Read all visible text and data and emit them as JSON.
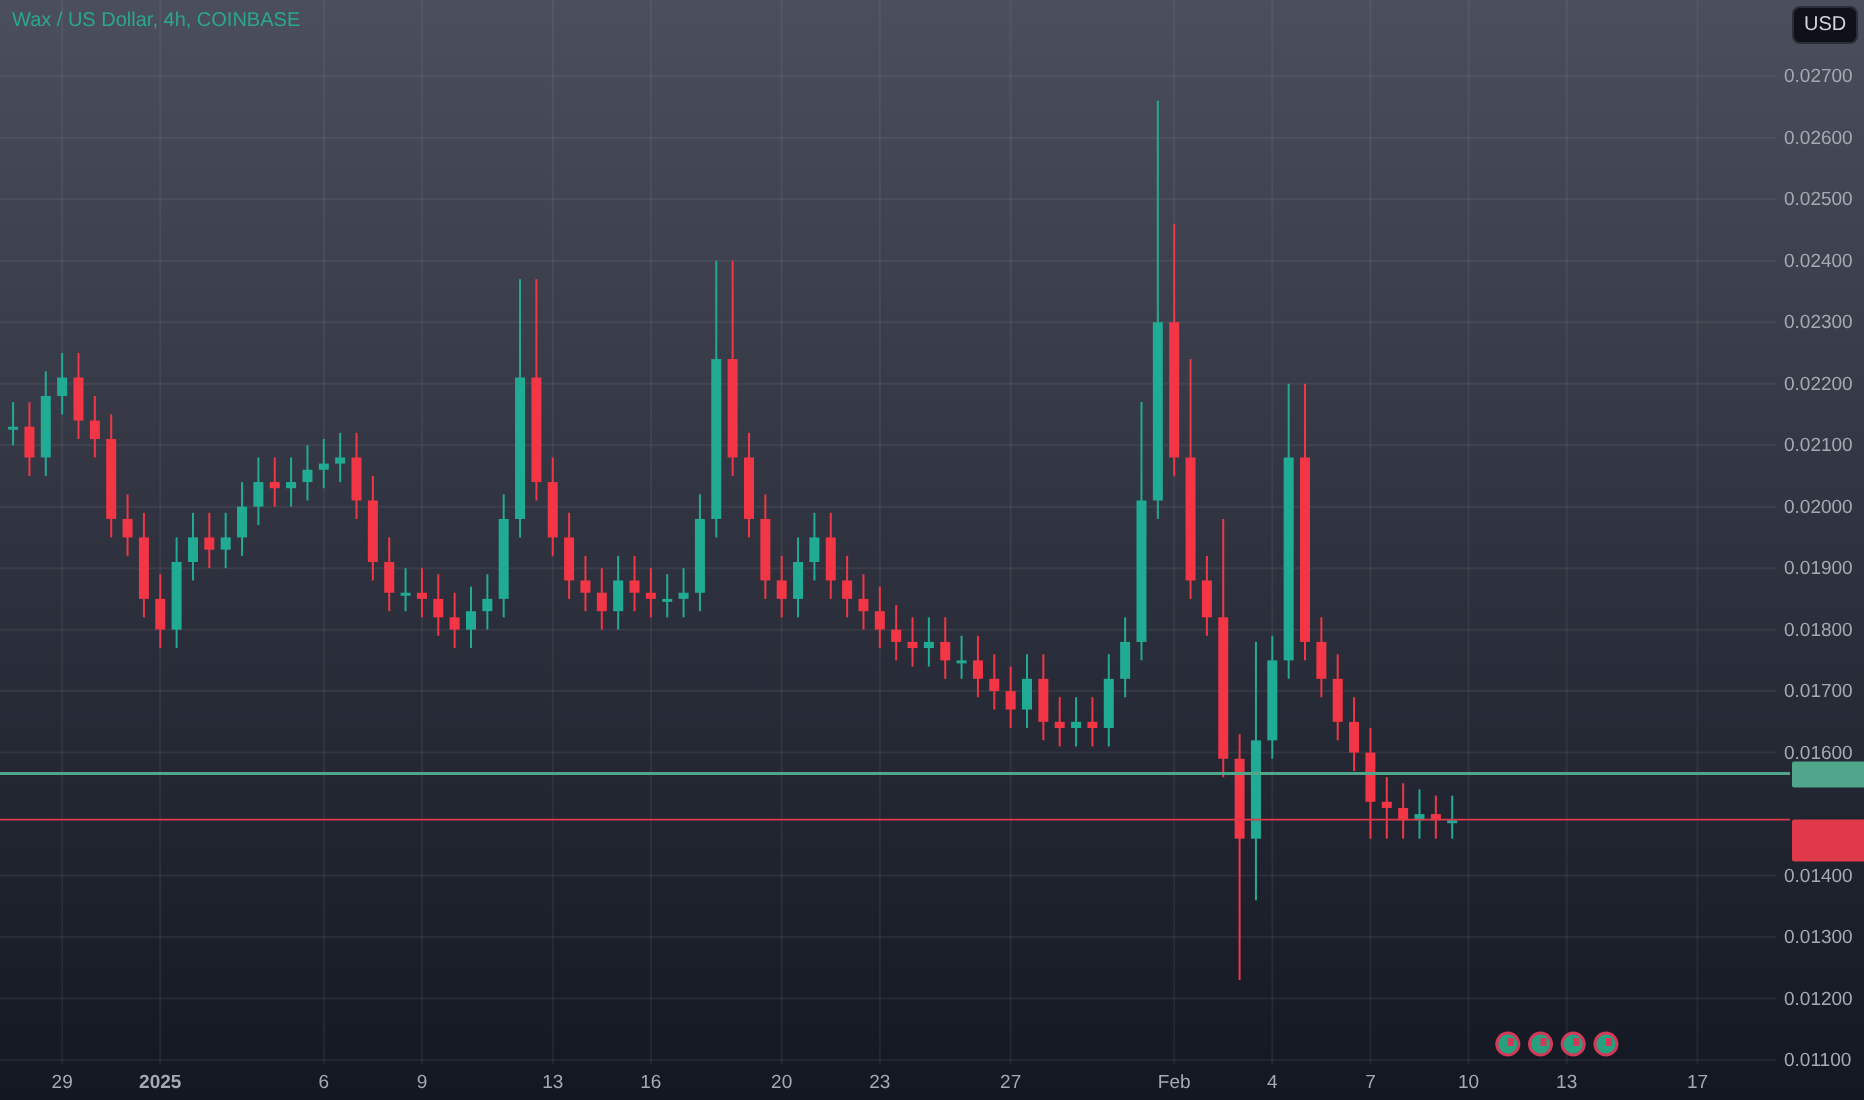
{
  "legend": {
    "title": "Wax / US Dollar, 4h, COINBASE"
  },
  "currency_button": {
    "label": "USD"
  },
  "chart_data": {
    "type": "candlestick",
    "categories": [
      null,
      null,
      null,
      "29",
      null,
      null,
      null,
      null,
      null,
      "2025",
      null,
      null,
      null,
      null,
      null,
      null,
      null,
      null,
      null,
      "6",
      null,
      null,
      null,
      null,
      null,
      "9",
      null,
      null,
      null,
      null,
      null,
      null,
      null,
      "13",
      null,
      null,
      null,
      null,
      null,
      "16",
      null,
      null,
      null,
      null,
      null,
      null,
      null,
      "20",
      null,
      null,
      null,
      null,
      null,
      "23",
      null,
      null,
      null,
      null,
      null,
      null,
      null,
      "27",
      null,
      null,
      null,
      null,
      null,
      null,
      null,
      null,
      null,
      "Feb",
      null,
      null,
      null,
      null,
      null,
      "4",
      null,
      null,
      null,
      null,
      null,
      "7",
      null,
      null,
      null,
      null,
      null,
      "10",
      null,
      null,
      null,
      null,
      null,
      "13",
      null,
      null,
      null,
      null,
      null,
      null,
      null,
      "17",
      null,
      null,
      null,
      null
    ],
    "ohlc": [
      [
        0.0213,
        0.0217,
        0.021,
        0.0213
      ],
      [
        0.0213,
        0.0217,
        0.0205,
        0.0208
      ],
      [
        0.0208,
        0.0222,
        0.0205,
        0.0218
      ],
      [
        0.0218,
        0.0225,
        0.0215,
        0.0221
      ],
      [
        0.0221,
        0.0225,
        0.0211,
        0.0214
      ],
      [
        0.0214,
        0.0218,
        0.0208,
        0.0211
      ],
      [
        0.0211,
        0.0215,
        0.0195,
        0.0198
      ],
      [
        0.0198,
        0.0202,
        0.0192,
        0.0195
      ],
      [
        0.0195,
        0.0199,
        0.0182,
        0.0185
      ],
      [
        0.0185,
        0.0189,
        0.0177,
        0.018
      ],
      [
        0.018,
        0.0195,
        0.0177,
        0.0191
      ],
      [
        0.0191,
        0.0199,
        0.0188,
        0.0195
      ],
      [
        0.0195,
        0.0199,
        0.019,
        0.0193
      ],
      [
        0.0193,
        0.0199,
        0.019,
        0.0195
      ],
      [
        0.0195,
        0.0204,
        0.0192,
        0.02
      ],
      [
        0.02,
        0.0208,
        0.0197,
        0.0204
      ],
      [
        0.0204,
        0.0208,
        0.02,
        0.0203
      ],
      [
        0.0203,
        0.0208,
        0.02,
        0.0204
      ],
      [
        0.0204,
        0.021,
        0.0201,
        0.0206
      ],
      [
        0.0206,
        0.0211,
        0.0203,
        0.0207
      ],
      [
        0.0207,
        0.0212,
        0.0204,
        0.0208
      ],
      [
        0.0208,
        0.0212,
        0.0198,
        0.0201
      ],
      [
        0.0201,
        0.0205,
        0.0188,
        0.0191
      ],
      [
        0.0191,
        0.0195,
        0.0183,
        0.0186
      ],
      [
        0.0186,
        0.019,
        0.0183,
        0.0186
      ],
      [
        0.0186,
        0.019,
        0.0182,
        0.0185
      ],
      [
        0.0185,
        0.0189,
        0.0179,
        0.0182
      ],
      [
        0.0182,
        0.0186,
        0.0177,
        0.018
      ],
      [
        0.018,
        0.0187,
        0.0177,
        0.0183
      ],
      [
        0.0183,
        0.0189,
        0.018,
        0.0185
      ],
      [
        0.0185,
        0.0202,
        0.0182,
        0.0198
      ],
      [
        0.0198,
        0.0237,
        0.0195,
        0.0221
      ],
      [
        0.0221,
        0.0237,
        0.0201,
        0.0204
      ],
      [
        0.0204,
        0.0208,
        0.0192,
        0.0195
      ],
      [
        0.0195,
        0.0199,
        0.0185,
        0.0188
      ],
      [
        0.0188,
        0.0192,
        0.0183,
        0.0186
      ],
      [
        0.0186,
        0.019,
        0.018,
        0.0183
      ],
      [
        0.0183,
        0.0192,
        0.018,
        0.0188
      ],
      [
        0.0188,
        0.0192,
        0.0183,
        0.0186
      ],
      [
        0.0186,
        0.019,
        0.0182,
        0.0185
      ],
      [
        0.0185,
        0.0189,
        0.0182,
        0.0185
      ],
      [
        0.0185,
        0.019,
        0.0182,
        0.0186
      ],
      [
        0.0186,
        0.0202,
        0.0183,
        0.0198
      ],
      [
        0.0198,
        0.024,
        0.0195,
        0.0224
      ],
      [
        0.0224,
        0.024,
        0.0205,
        0.0208
      ],
      [
        0.0208,
        0.0212,
        0.0195,
        0.0198
      ],
      [
        0.0198,
        0.0202,
        0.0185,
        0.0188
      ],
      [
        0.0188,
        0.0192,
        0.0182,
        0.0185
      ],
      [
        0.0185,
        0.0195,
        0.0182,
        0.0191
      ],
      [
        0.0191,
        0.0199,
        0.0188,
        0.0195
      ],
      [
        0.0195,
        0.0199,
        0.0185,
        0.0188
      ],
      [
        0.0188,
        0.0192,
        0.0182,
        0.0185
      ],
      [
        0.0185,
        0.0189,
        0.018,
        0.0183
      ],
      [
        0.0183,
        0.0187,
        0.0177,
        0.018
      ],
      [
        0.018,
        0.0184,
        0.0175,
        0.0178
      ],
      [
        0.0178,
        0.0182,
        0.0174,
        0.0177
      ],
      [
        0.0177,
        0.0182,
        0.0174,
        0.0178
      ],
      [
        0.0178,
        0.0182,
        0.0172,
        0.0175
      ],
      [
        0.0175,
        0.0179,
        0.0172,
        0.0175
      ],
      [
        0.0175,
        0.0179,
        0.0169,
        0.0172
      ],
      [
        0.0172,
        0.0176,
        0.0167,
        0.017
      ],
      [
        0.017,
        0.0174,
        0.0164,
        0.0167
      ],
      [
        0.0167,
        0.0176,
        0.0164,
        0.0172
      ],
      [
        0.0172,
        0.0176,
        0.0162,
        0.0165
      ],
      [
        0.0165,
        0.0169,
        0.0161,
        0.0164
      ],
      [
        0.0164,
        0.0169,
        0.0161,
        0.0165
      ],
      [
        0.0165,
        0.0169,
        0.0161,
        0.0164
      ],
      [
        0.0164,
        0.0176,
        0.0161,
        0.0172
      ],
      [
        0.0172,
        0.0182,
        0.0169,
        0.0178
      ],
      [
        0.0178,
        0.0217,
        0.0175,
        0.0201
      ],
      [
        0.0201,
        0.0266,
        0.0198,
        0.023
      ],
      [
        0.023,
        0.0246,
        0.0205,
        0.0208
      ],
      [
        0.0208,
        0.0224,
        0.0185,
        0.0188
      ],
      [
        0.0188,
        0.0192,
        0.0179,
        0.0182
      ],
      [
        0.0182,
        0.0198,
        0.0156,
        0.0159
      ],
      [
        0.0159,
        0.0163,
        0.0123,
        0.0146
      ],
      [
        0.0146,
        0.0178,
        0.0136,
        0.0162
      ],
      [
        0.0162,
        0.0179,
        0.0159,
        0.0175
      ],
      [
        0.0175,
        0.022,
        0.0172,
        0.0208
      ],
      [
        0.0208,
        0.022,
        0.0175,
        0.0178
      ],
      [
        0.0178,
        0.0182,
        0.0169,
        0.0172
      ],
      [
        0.0172,
        0.0176,
        0.0162,
        0.0165
      ],
      [
        0.0165,
        0.0169,
        0.0157,
        0.016
      ],
      [
        0.016,
        0.0164,
        0.0146,
        0.0152
      ],
      [
        0.0152,
        0.0156,
        0.0146,
        0.0151
      ],
      [
        0.0151,
        0.0155,
        0.0146,
        0.0149
      ],
      [
        0.0149,
        0.0154,
        0.0146,
        0.015
      ],
      [
        0.015,
        0.0153,
        0.0146,
        0.0149
      ],
      [
        0.0149,
        0.0153,
        0.0146,
        0.0149
      ],
      null,
      null,
      null,
      null,
      null,
      null,
      null,
      null,
      null,
      null,
      null,
      null,
      null,
      null,
      null,
      null,
      null,
      null,
      null
    ],
    "grid": true,
    "ylim": [
      0.01035,
      0.02824
    ],
    "yticks": [
      {
        "value": 0.027,
        "label": "0.02700"
      },
      {
        "value": 0.026,
        "label": "0.02600"
      },
      {
        "value": 0.025,
        "label": "0.02500"
      },
      {
        "value": 0.024,
        "label": "0.02400"
      },
      {
        "value": 0.023,
        "label": "0.02300"
      },
      {
        "value": 0.022,
        "label": "0.02200"
      },
      {
        "value": 0.021,
        "label": "0.02100"
      },
      {
        "value": 0.02,
        "label": "0.02000"
      },
      {
        "value": 0.019,
        "label": "0.01900"
      },
      {
        "value": 0.018,
        "label": "0.01800"
      },
      {
        "value": 0.017,
        "label": "0.01700"
      },
      {
        "value": 0.016,
        "label": "0.01600"
      },
      {
        "value": 0.014,
        "label": "0.01400"
      },
      {
        "value": 0.013,
        "label": "0.01300"
      },
      {
        "value": 0.012,
        "label": "0.01200"
      },
      {
        "value": 0.011,
        "label": "0.01100"
      }
    ],
    "ref_lines": [
      {
        "axis": "y",
        "value": 0.01566,
        "color": "#4fa68a"
      },
      {
        "axis": "y",
        "value": 0.01491,
        "color": "#e0394a"
      }
    ]
  },
  "event_markers": [
    {
      "kind": "event"
    },
    {
      "kind": "event"
    },
    {
      "kind": "event"
    },
    {
      "kind": "event"
    }
  ]
}
